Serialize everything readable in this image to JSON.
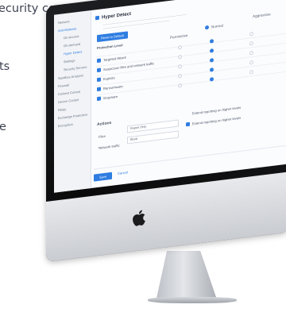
{
  "background_text": [
    "ecurity control",
    "ts",
    "e"
  ],
  "sidebar": {
    "items": [
      {
        "label": "Network",
        "sub": false,
        "active": false
      },
      {
        "label": "Anti-Malware",
        "sub": false,
        "active": true
      },
      {
        "label": "On-Access",
        "sub": true,
        "active": false
      },
      {
        "label": "On-demand",
        "sub": true,
        "active": false
      },
      {
        "label": "Hyper Detect",
        "sub": true,
        "active": true
      },
      {
        "label": "Settings",
        "sub": true,
        "active": false
      },
      {
        "label": "Security Servers",
        "sub": true,
        "active": false
      },
      {
        "label": "Sandbox Analyzer",
        "sub": false,
        "active": false
      },
      {
        "label": "Firewall",
        "sub": false,
        "active": false
      },
      {
        "label": "Content Control",
        "sub": false,
        "active": false
      },
      {
        "label": "Device Control",
        "sub": false,
        "active": false
      },
      {
        "label": "Relay",
        "sub": false,
        "active": false
      },
      {
        "label": "Exchange Protection",
        "sub": false,
        "active": false
      },
      {
        "label": "Encryption",
        "sub": false,
        "active": false
      }
    ]
  },
  "main": {
    "title": "Hyper Detect",
    "reset_button": "Reset to Default",
    "protection_level_label": "Protection Level",
    "columns": [
      "Permissive",
      "Normal",
      "Aggressive"
    ],
    "rows": [
      "Targeted Attack",
      "Suspicious files and network traffic",
      "Exploits",
      "Ransomware",
      "Grayware"
    ],
    "actions_label": "Actions",
    "files_label": "Files",
    "network_label": "Network traffic",
    "files_value": "Report Only",
    "network_value": "Block",
    "extend_label": "Extend reporting on higher levels",
    "save_button": "Save",
    "cancel_button": "Cancel"
  },
  "colors": {
    "accent": "#2f7de1",
    "text": "#3c4352"
  }
}
